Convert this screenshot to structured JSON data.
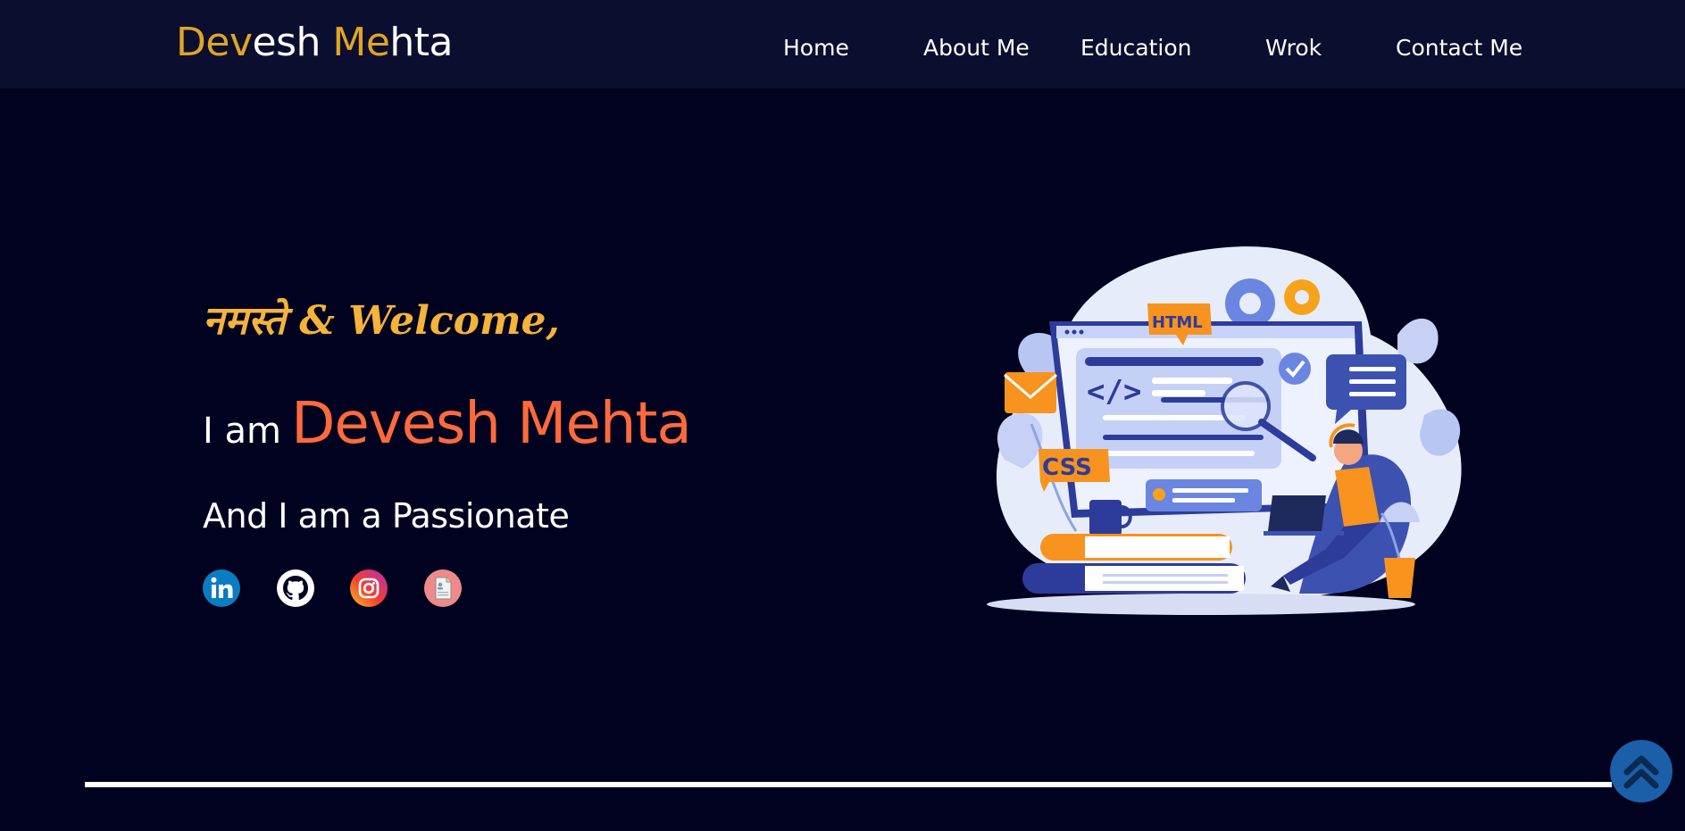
{
  "header": {
    "logo": {
      "part1": "Dev",
      "part2": "esh ",
      "part3": "Me",
      "part4": "hta"
    },
    "nav": [
      "Home",
      "About Me",
      "Education",
      "Wrok",
      "Contact Me"
    ]
  },
  "hero": {
    "greeting": "नमस्ते & Welcome,",
    "intro_prefix": "I am",
    "name": "Devesh Mehta",
    "tagline": "And I am a Passionate",
    "socials": [
      {
        "icon": "linkedin-icon"
      },
      {
        "icon": "github-icon"
      },
      {
        "icon": "instagram-icon"
      },
      {
        "icon": "resume-icon"
      }
    ],
    "illustration_labels": {
      "html": "HTML",
      "css": "CSS",
      "code": "</>"
    }
  },
  "colors": {
    "nav_bg": "#0b0e2e",
    "page_bg": "#00021f",
    "logo_accent": "#e0a526",
    "greeting": "#f5b339",
    "name": "#ff6a3d",
    "scroll_top": "#1a5fa8"
  },
  "scroll_top": {
    "icon": "double-chevron-up-icon"
  }
}
